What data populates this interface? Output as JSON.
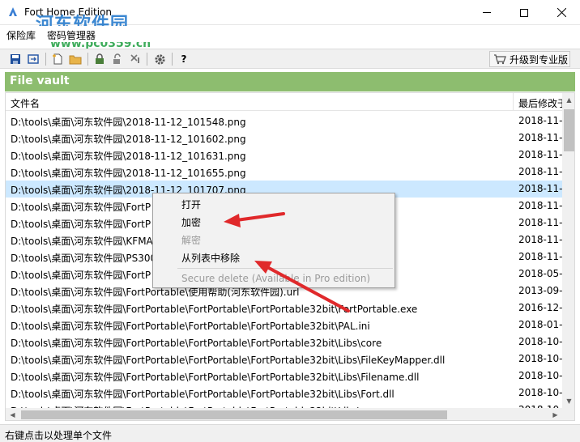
{
  "window": {
    "title": "Fort Home Edition",
    "watermark": "河东软件园",
    "watermark_url": "www.pc0359.cn"
  },
  "menu": {
    "items": [
      "保险库",
      "密码管理器"
    ]
  },
  "toolbar": {
    "icons": [
      "save-icon",
      "export-icon",
      "new-file-icon",
      "folder-icon",
      "lock-icon",
      "unlock-icon",
      "delete-icon",
      "settings-icon",
      "help-icon"
    ],
    "upgrade_label": "升级到专业版",
    "help_label": "?"
  },
  "vault": {
    "header": "File vault",
    "columns": {
      "name": "文件名",
      "modified": "最后修改于"
    },
    "rows": [
      {
        "name": "D:\\tools\\桌面\\河东软件园\\2018-11-12_101548.png",
        "date": "2018-11-1"
      },
      {
        "name": "D:\\tools\\桌面\\河东软件园\\2018-11-12_101602.png",
        "date": "2018-11-1"
      },
      {
        "name": "D:\\tools\\桌面\\河东软件园\\2018-11-12_101631.png",
        "date": "2018-11-1"
      },
      {
        "name": "D:\\tools\\桌面\\河东软件园\\2018-11-12_101655.png",
        "date": "2018-11-1"
      },
      {
        "name": "D:\\tools\\桌面\\河东软件园\\2018-11-12_101707.png",
        "date": "2018-11-1"
      },
      {
        "name": "D:\\tools\\桌面\\河东软件园\\FortP",
        "date": "2018-11-1"
      },
      {
        "name": "D:\\tools\\桌面\\河东软件园\\FortP",
        "date": "2018-11-1"
      },
      {
        "name": "D:\\tools\\桌面\\河东软件园\\KFMA",
        "date": "2018-11-1"
      },
      {
        "name": "D:\\tools\\桌面\\河东软件园\\PS300",
        "date": "2018-11-1"
      },
      {
        "name": "D:\\tools\\桌面\\河东软件园\\FortP",
        "date": "2018-05-2"
      },
      {
        "name": "D:\\tools\\桌面\\河东软件园\\FortPortable\\使用帮助(河东软件园).url",
        "date": "2013-09-1"
      },
      {
        "name": "D:\\tools\\桌面\\河东软件园\\FortPortable\\FortPortable\\FortPortable32bit\\FortPortable.exe",
        "date": "2016-12-2"
      },
      {
        "name": "D:\\tools\\桌面\\河东软件园\\FortPortable\\FortPortable\\FortPortable32bit\\PAL.ini",
        "date": "2018-01-2"
      },
      {
        "name": "D:\\tools\\桌面\\河东软件园\\FortPortable\\FortPortable\\FortPortable32bit\\Libs\\core",
        "date": "2018-10-2"
      },
      {
        "name": "D:\\tools\\桌面\\河东软件园\\FortPortable\\FortPortable\\FortPortable32bit\\Libs\\FileKeyMapper.dll",
        "date": "2018-10-2"
      },
      {
        "name": "D:\\tools\\桌面\\河东软件园\\FortPortable\\FortPortable\\FortPortable32bit\\Libs\\Filename.dll",
        "date": "2018-10-2"
      },
      {
        "name": "D:\\tools\\桌面\\河东软件园\\FortPortable\\FortPortable\\FortPortable32bit\\Libs\\Fort.dll",
        "date": "2018-10-2"
      },
      {
        "name": "D:\\tools\\桌面\\河东软件园\\FortPortable\\FortPortable\\FortPortable32bit\\Libs\\...",
        "date": "2018-10-2"
      }
    ],
    "selected_index": 4
  },
  "context_menu": {
    "open": "打开",
    "encrypt": "加密",
    "decrypt": "解密",
    "remove": "从列表中移除",
    "secure_delete": "Secure delete (Available in Pro edition)"
  },
  "status": {
    "text": "右键点击以处理单个文件"
  },
  "colors": {
    "vault_header_bg": "#8dbd6f",
    "selected_row": "#cce8ff",
    "annotation_arrow": "#e0292b"
  }
}
